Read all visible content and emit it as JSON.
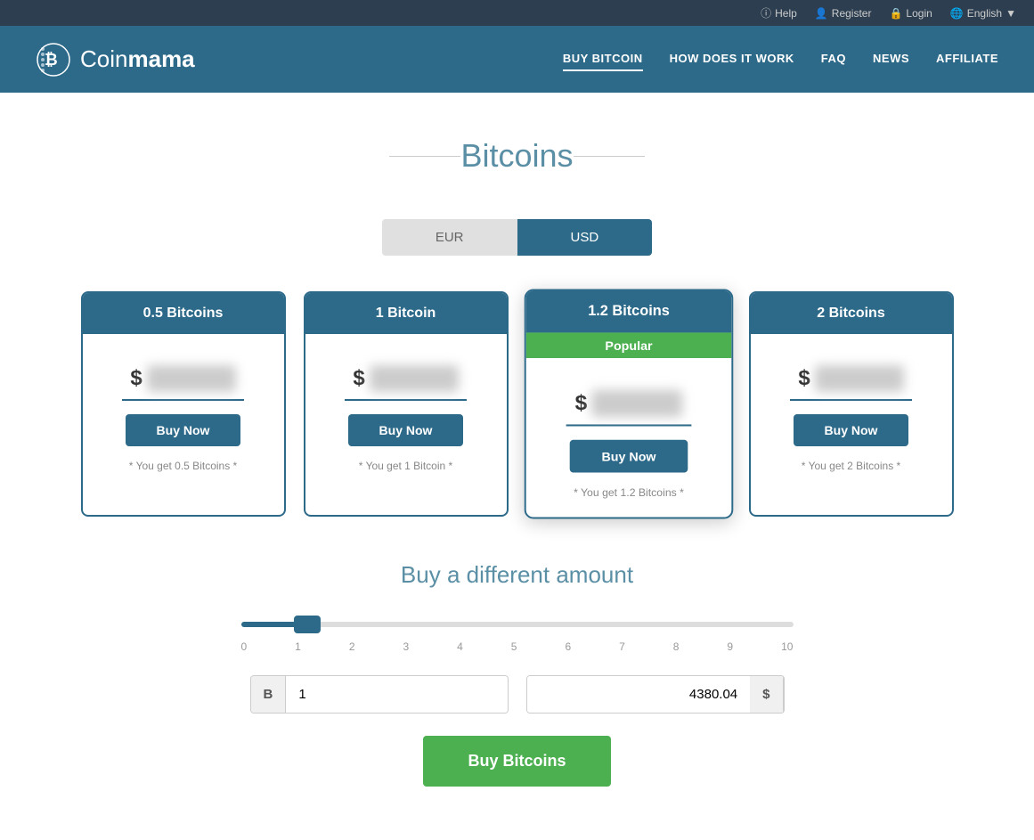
{
  "topbar": {
    "help_label": "Help",
    "register_label": "Register",
    "login_label": "Login",
    "language_label": "English"
  },
  "header": {
    "logo_text_part1": "Coin",
    "logo_text_part2": "mama",
    "nav": {
      "item1": "BUY BITCOIN",
      "item2": "HOW DOES IT WORK",
      "item3": "FAQ",
      "item4": "NEWS",
      "item5": "AFFILIATE"
    }
  },
  "page": {
    "title": "Bitcoins",
    "currency_eur": "EUR",
    "currency_usd": "USD"
  },
  "cards": [
    {
      "title": "0.5 Bitcoins",
      "price_symbol": "$",
      "popular": false,
      "buy_label": "Buy Now",
      "you_get": "* You get 0.5 Bitcoins *"
    },
    {
      "title": "1 Bitcoin",
      "price_symbol": "$",
      "popular": false,
      "buy_label": "Buy Now",
      "you_get": "* You get 1 Bitcoin *"
    },
    {
      "title": "1.2 Bitcoins",
      "price_symbol": "$",
      "popular": true,
      "popular_label": "Popular",
      "buy_label": "Buy Now",
      "you_get": "* You get 1.2 Bitcoins *"
    },
    {
      "title": "2 Bitcoins",
      "price_symbol": "$",
      "popular": false,
      "buy_label": "Buy Now",
      "you_get": "* You get 2 Bitcoins *"
    }
  ],
  "custom": {
    "title": "Buy a different amount",
    "slider_labels": [
      "0",
      "1",
      "2",
      "3",
      "4",
      "5",
      "6",
      "7",
      "8",
      "9",
      "10"
    ],
    "btc_prefix": "B",
    "btc_value": "1",
    "usd_value": "4380.04",
    "usd_suffix": "$",
    "buy_button": "Buy Bitcoins"
  }
}
